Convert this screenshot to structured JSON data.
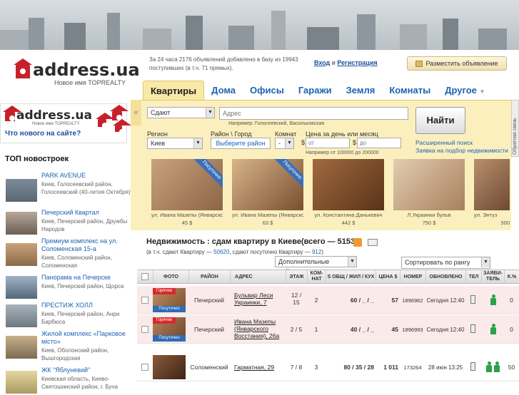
{
  "header": {
    "logo_text": "address.ua",
    "logo_sub": "Новое имя TOPREALTY",
    "stats": "За 24 часа 2176 объявлений добавлено в базу из 19943 поступивших (в т.ч. 71 прямых).",
    "login_label": "Вход",
    "login_and": "и",
    "register_label": "Регистрация",
    "post_button": "Разместить объявление"
  },
  "tabs": [
    "Квартиры",
    "Дома",
    "Офисы",
    "Гаражи",
    "Земля",
    "Комнаты",
    "Другое"
  ],
  "search": {
    "deal_value": "Сдают",
    "address_placeholder": "Адрес",
    "address_hint": "Например: Голосеевский, Васильковская",
    "find_button": "Найти",
    "advanced_link": "Расширенный поиск",
    "request_link": "Заявка на подбор недвижимости",
    "region_label": "Регион",
    "region_value": "Киев",
    "district_label": "Район \\ Город",
    "district_value": "Выберите район",
    "rooms_label": "Комнат",
    "rooms_value": "-",
    "price_label": "Цена за день или месяц",
    "price_from_placeholder": "от",
    "price_to_placeholder": "до",
    "currency": "$",
    "price_hint": "Например от 100000 до 200000",
    "feedback": "Обратная связь",
    "collapse_icon": "«"
  },
  "featured": [
    {
      "caption": "ул. Ивана Мазепы (Январско",
      "price": "45 $",
      "ribbon": "Посуточно"
    },
    {
      "caption": "ул. Ивана Мазепы (Январско",
      "price": "63 $",
      "ribbon": "Посуточно"
    },
    {
      "caption": "ул. Константина Данькевич",
      "price": "442 $",
      "ribbon": ""
    },
    {
      "caption": "Л.Украинки бульв",
      "price": "750 $",
      "ribbon": ""
    },
    {
      "caption": "ул. Энтуз",
      "price": "500",
      "ribbon": ""
    }
  ],
  "sidebar": {
    "promo_text": "Что нового на сайте?",
    "top_title": "ТОП новостроек",
    "items": [
      {
        "name": "PARK AVENUE",
        "desc": "Киев, Голосеевский район, Голосеевский (40-летия Октября)"
      },
      {
        "name": "Печерский Квартал",
        "desc": "Киев, Печерский район, Дружбы Народов"
      },
      {
        "name": "Премиум комплекс на ул. Соломенская 15-а",
        "desc": "Киев, Соломенский район, Соломенская"
      },
      {
        "name": "Панорама на Печерске",
        "desc": "Киев, Печерский район, Щорса"
      },
      {
        "name": "ПРЕСТИЖ ХОЛЛ",
        "desc": "Киев, Печерский район, Анри Барбюса"
      },
      {
        "name": "Жилой комплекс «Парковое місто»",
        "desc": "Киев, Оболонский район, Вышгородская"
      },
      {
        "name": "ЖК \"Яблуневий\"",
        "desc": "Киевская область, Киево-Святошинский район, г. Буча"
      }
    ]
  },
  "results": {
    "title": "Недвижимость : сдам квартиру в Киеве(всего — 51532)",
    "sub_prefix": "(в т.ч. сдают Квартиру —",
    "sub_count1": "50620",
    "sub_mid": ", сдают посуточно Квартиру —",
    "sub_count2": "912",
    "sub_suffix": ")",
    "actions_select": "Дополнительные действия",
    "sort_select": "Сортировать по рангу",
    "columns": [
      "ФОТО",
      "РАЙОН",
      "АДРЕС",
      "ЭТАЖ",
      "КОМ-НАТ",
      "S ОБЩ / ЖИЛ / КУХ",
      "ЦЕНА $",
      "НОМЕР",
      "ОБНОВЛЕНО",
      "ТЕЛ",
      "ЗАЯВИ-ТЕЛЬ",
      "К.%"
    ],
    "hot_label": "Горячее",
    "daily_label": "Посуточно",
    "rows": [
      {
        "district": "Печерский",
        "address1": "Бульвар Леси",
        "address2": "Украинки, 7",
        "floor1": "12 /",
        "floor2": "15",
        "rooms": "2",
        "area": "60 / _ / _",
        "price": "57",
        "number": "1896962",
        "updated": "Сегодня 12:40",
        "commission": "0",
        "hot": true
      },
      {
        "district": "Печерский",
        "address1": "Ивана Мазепы",
        "address2": "(Январского",
        "address3": "Восстания), 26а",
        "floor1": "2 / 5",
        "floor2": "",
        "rooms": "1",
        "area": "40 / _ / _",
        "price": "45",
        "number": "1896993",
        "updated": "Сегодня 12:40",
        "commission": "0",
        "hot": true
      },
      {
        "district": "Соломенский",
        "address1": "Гарматная, 29",
        "address2": "",
        "floor1": "7 / 8",
        "floor2": "",
        "rooms": "3",
        "area": "80 / 35 / 28",
        "price": "1 011",
        "number": "173264",
        "updated": "28 июн 13:25",
        "commission": "50",
        "hot": false
      }
    ]
  }
}
